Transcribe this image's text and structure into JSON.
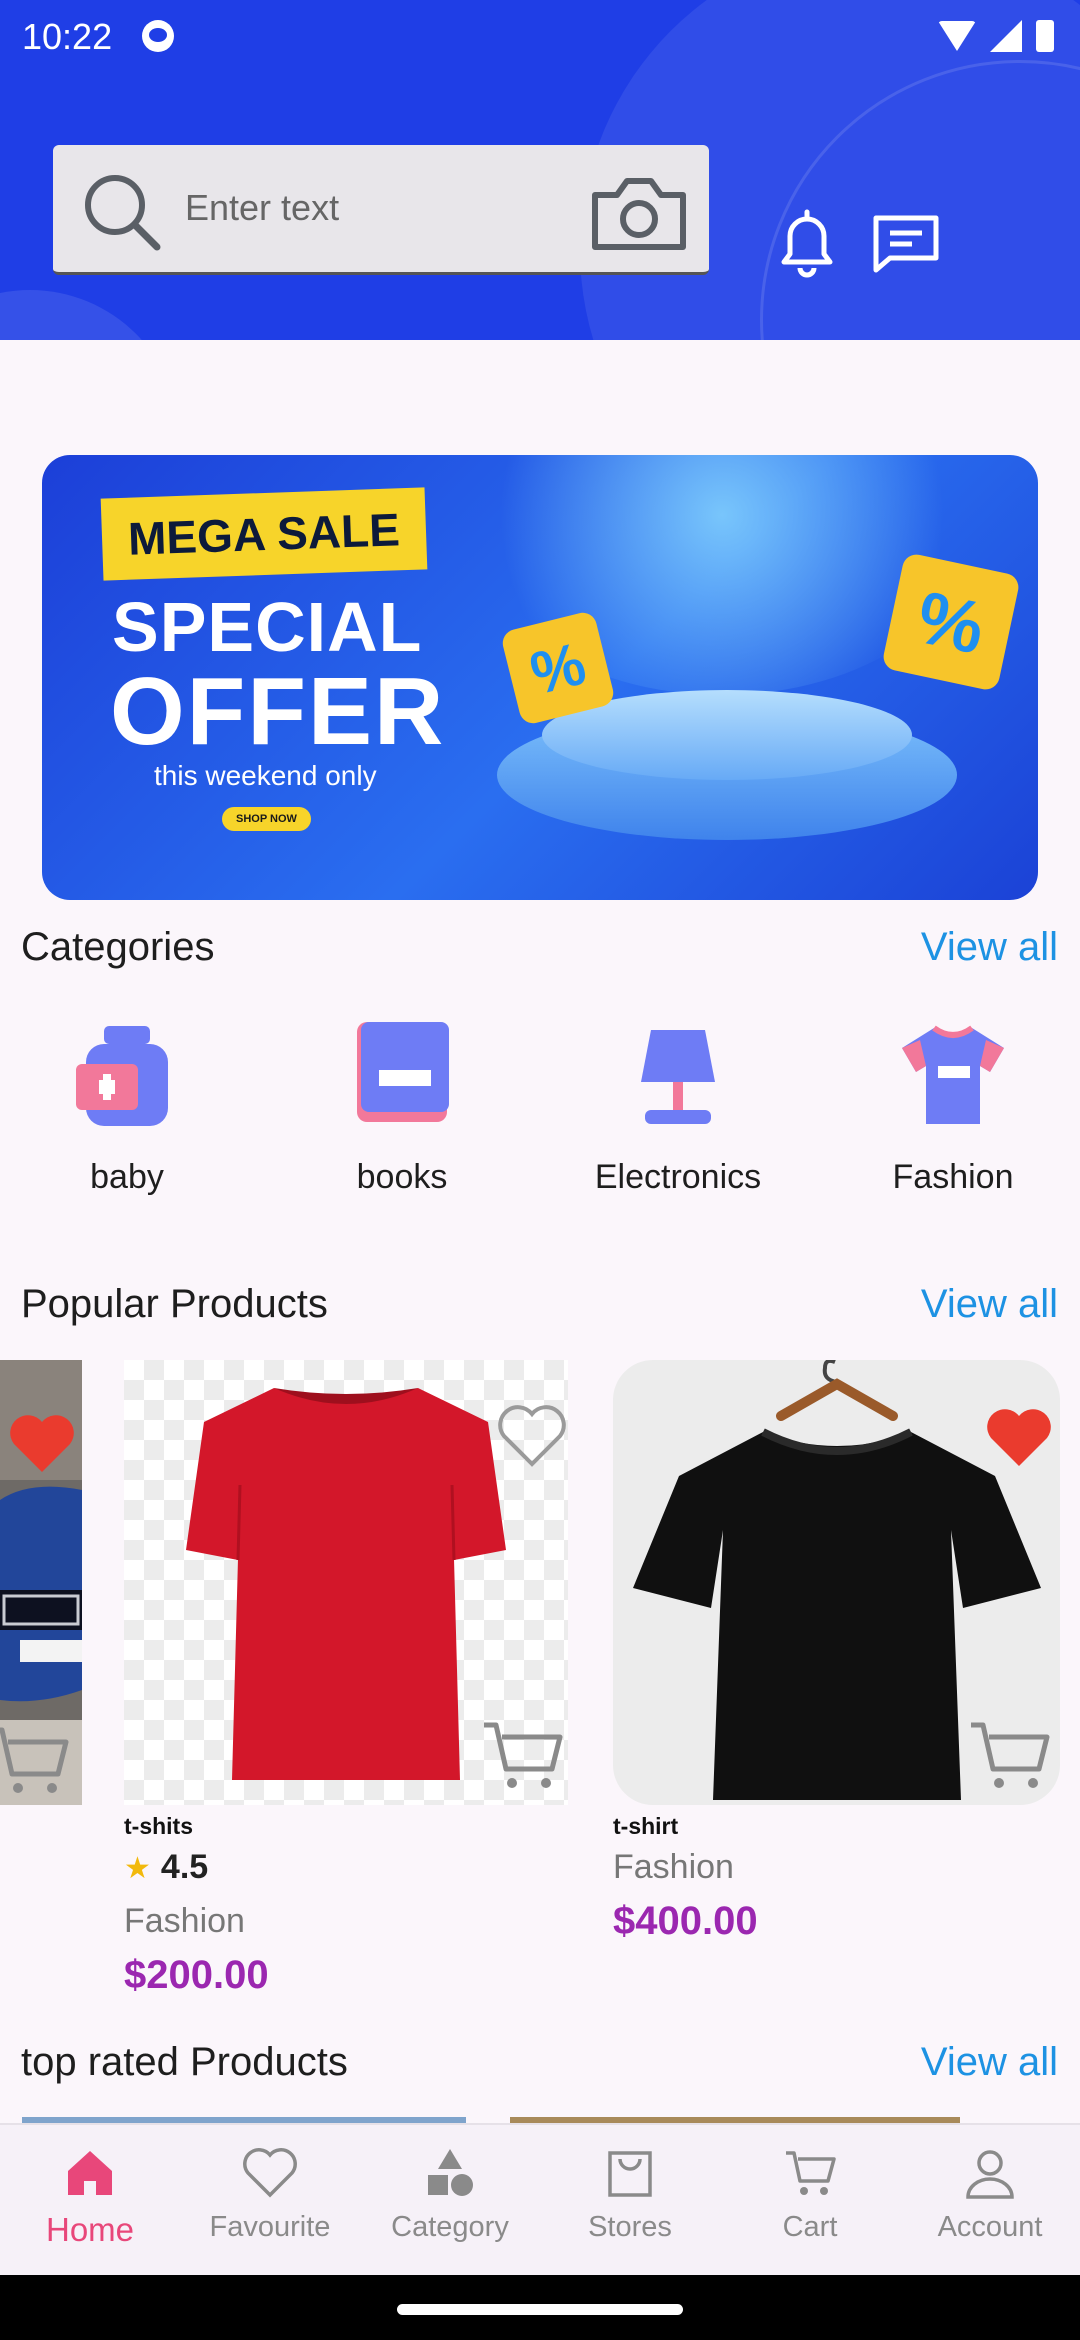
{
  "status_bar": {
    "time": "10:22"
  },
  "search": {
    "placeholder": "Enter text"
  },
  "banner": {
    "tag": "MEGA SALE",
    "title_line1": "SPECIAL",
    "title_line2": "OFFER",
    "subtitle": "this weekend only",
    "button": "SHOP NOW",
    "badge_symbol": "%"
  },
  "categories": {
    "title": "Categories",
    "view_all": "View all",
    "items": [
      {
        "label": "baby",
        "icon": "baby-bottle-icon"
      },
      {
        "label": "books",
        "icon": "book-icon"
      },
      {
        "label": "Electronics",
        "icon": "lamp-icon"
      },
      {
        "label": "Fashion",
        "icon": "tshirt-icon"
      }
    ]
  },
  "popular": {
    "title": "Popular Products",
    "view_all": "View all",
    "products": [
      {
        "name": "t-shits",
        "rating": "4.5",
        "category": "Fashion",
        "price": "$200.00",
        "favorite": false
      },
      {
        "name": "t-shirt",
        "category": "Fashion",
        "price": "$400.00",
        "favorite": true
      }
    ]
  },
  "top_rated": {
    "title": "top rated Products",
    "view_all": "View all"
  },
  "nav": {
    "items": [
      {
        "label": "Home",
        "icon": "home-icon",
        "active": true
      },
      {
        "label": "Favourite",
        "icon": "heart-icon"
      },
      {
        "label": "Category",
        "icon": "shapes-icon"
      },
      {
        "label": "Stores",
        "icon": "bag-icon"
      },
      {
        "label": "Cart",
        "icon": "cart-icon"
      },
      {
        "label": "Account",
        "icon": "person-icon"
      }
    ]
  },
  "colors": {
    "header_blue": "#1f3ee6",
    "accent_link": "#1d92e3",
    "price_purple": "#9b27b0",
    "nav_active": "#e8477a",
    "favorite_red": "#ea3b2e"
  }
}
